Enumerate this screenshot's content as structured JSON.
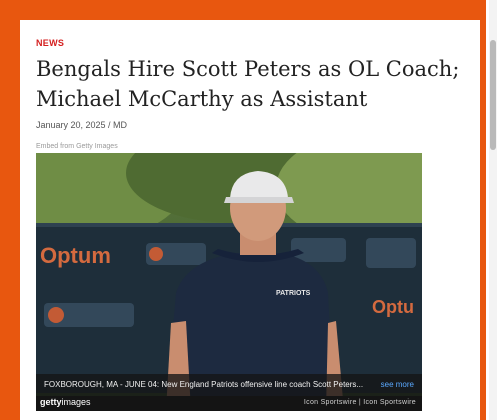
{
  "article": {
    "category": "NEWS",
    "headline": "Bengals Hire Scott Peters as OL Coach; Michael McCarthy as Assistant",
    "byline": "January 20, 2025 / MD"
  },
  "embed": {
    "source_note": "Embed from Getty Images",
    "caption": "FOXBOROUGH, MA - JUNE 04: New England Patriots offensive line coach Scott Peters...",
    "see_more": "see more",
    "logo_bold": "getty",
    "logo_light": "images",
    "credit": "Icon Sportswire | Icon Sportswire",
    "banner_left": "Optum",
    "banner_right": "Optu",
    "shirt_text": "PATRIOTS"
  },
  "colors": {
    "page_background": "#e8570f",
    "category_red": "#d41e1e",
    "link_blue": "#5aa9ff"
  },
  "icons": {
    "scrollbar": "scrollbar"
  }
}
